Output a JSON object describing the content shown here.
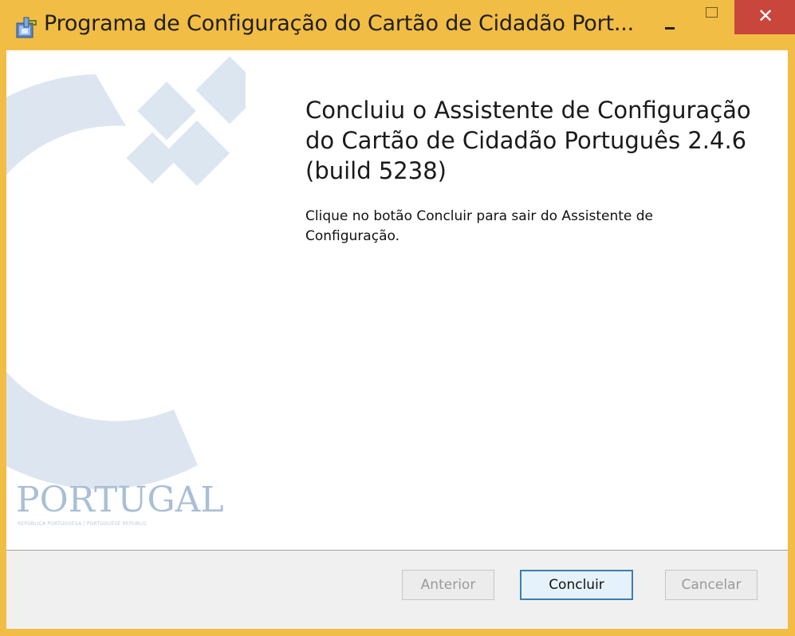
{
  "window": {
    "title": "Programa de Configuração do Cartão de Cidadão Port...",
    "controls": {
      "minimize_icon": "minimize-icon",
      "maximize_icon": "maximize-icon",
      "close_icon": "close-icon",
      "close_glyph": "✕"
    }
  },
  "content": {
    "heading": "Concluiu o Assistente de Configuração do Cartão de Cidadão Português 2.4.6 (build 5238)",
    "description": "Clique no botão Concluir para sair do Assistente de Configuração."
  },
  "branding": {
    "logo_text": "PORTUGAL",
    "logo_subtitle": "REPÚBLICA PORTUGUESA | PORTUGUESE REPUBLIC"
  },
  "buttons": {
    "back": "Anterior",
    "finish": "Concluir",
    "cancel": "Cancelar"
  },
  "colors": {
    "title_bar": "#f2bd45",
    "close_button": "#c9463d",
    "accent_button_border": "#3c7fb1",
    "banner_shape": "#dbe5ef"
  }
}
